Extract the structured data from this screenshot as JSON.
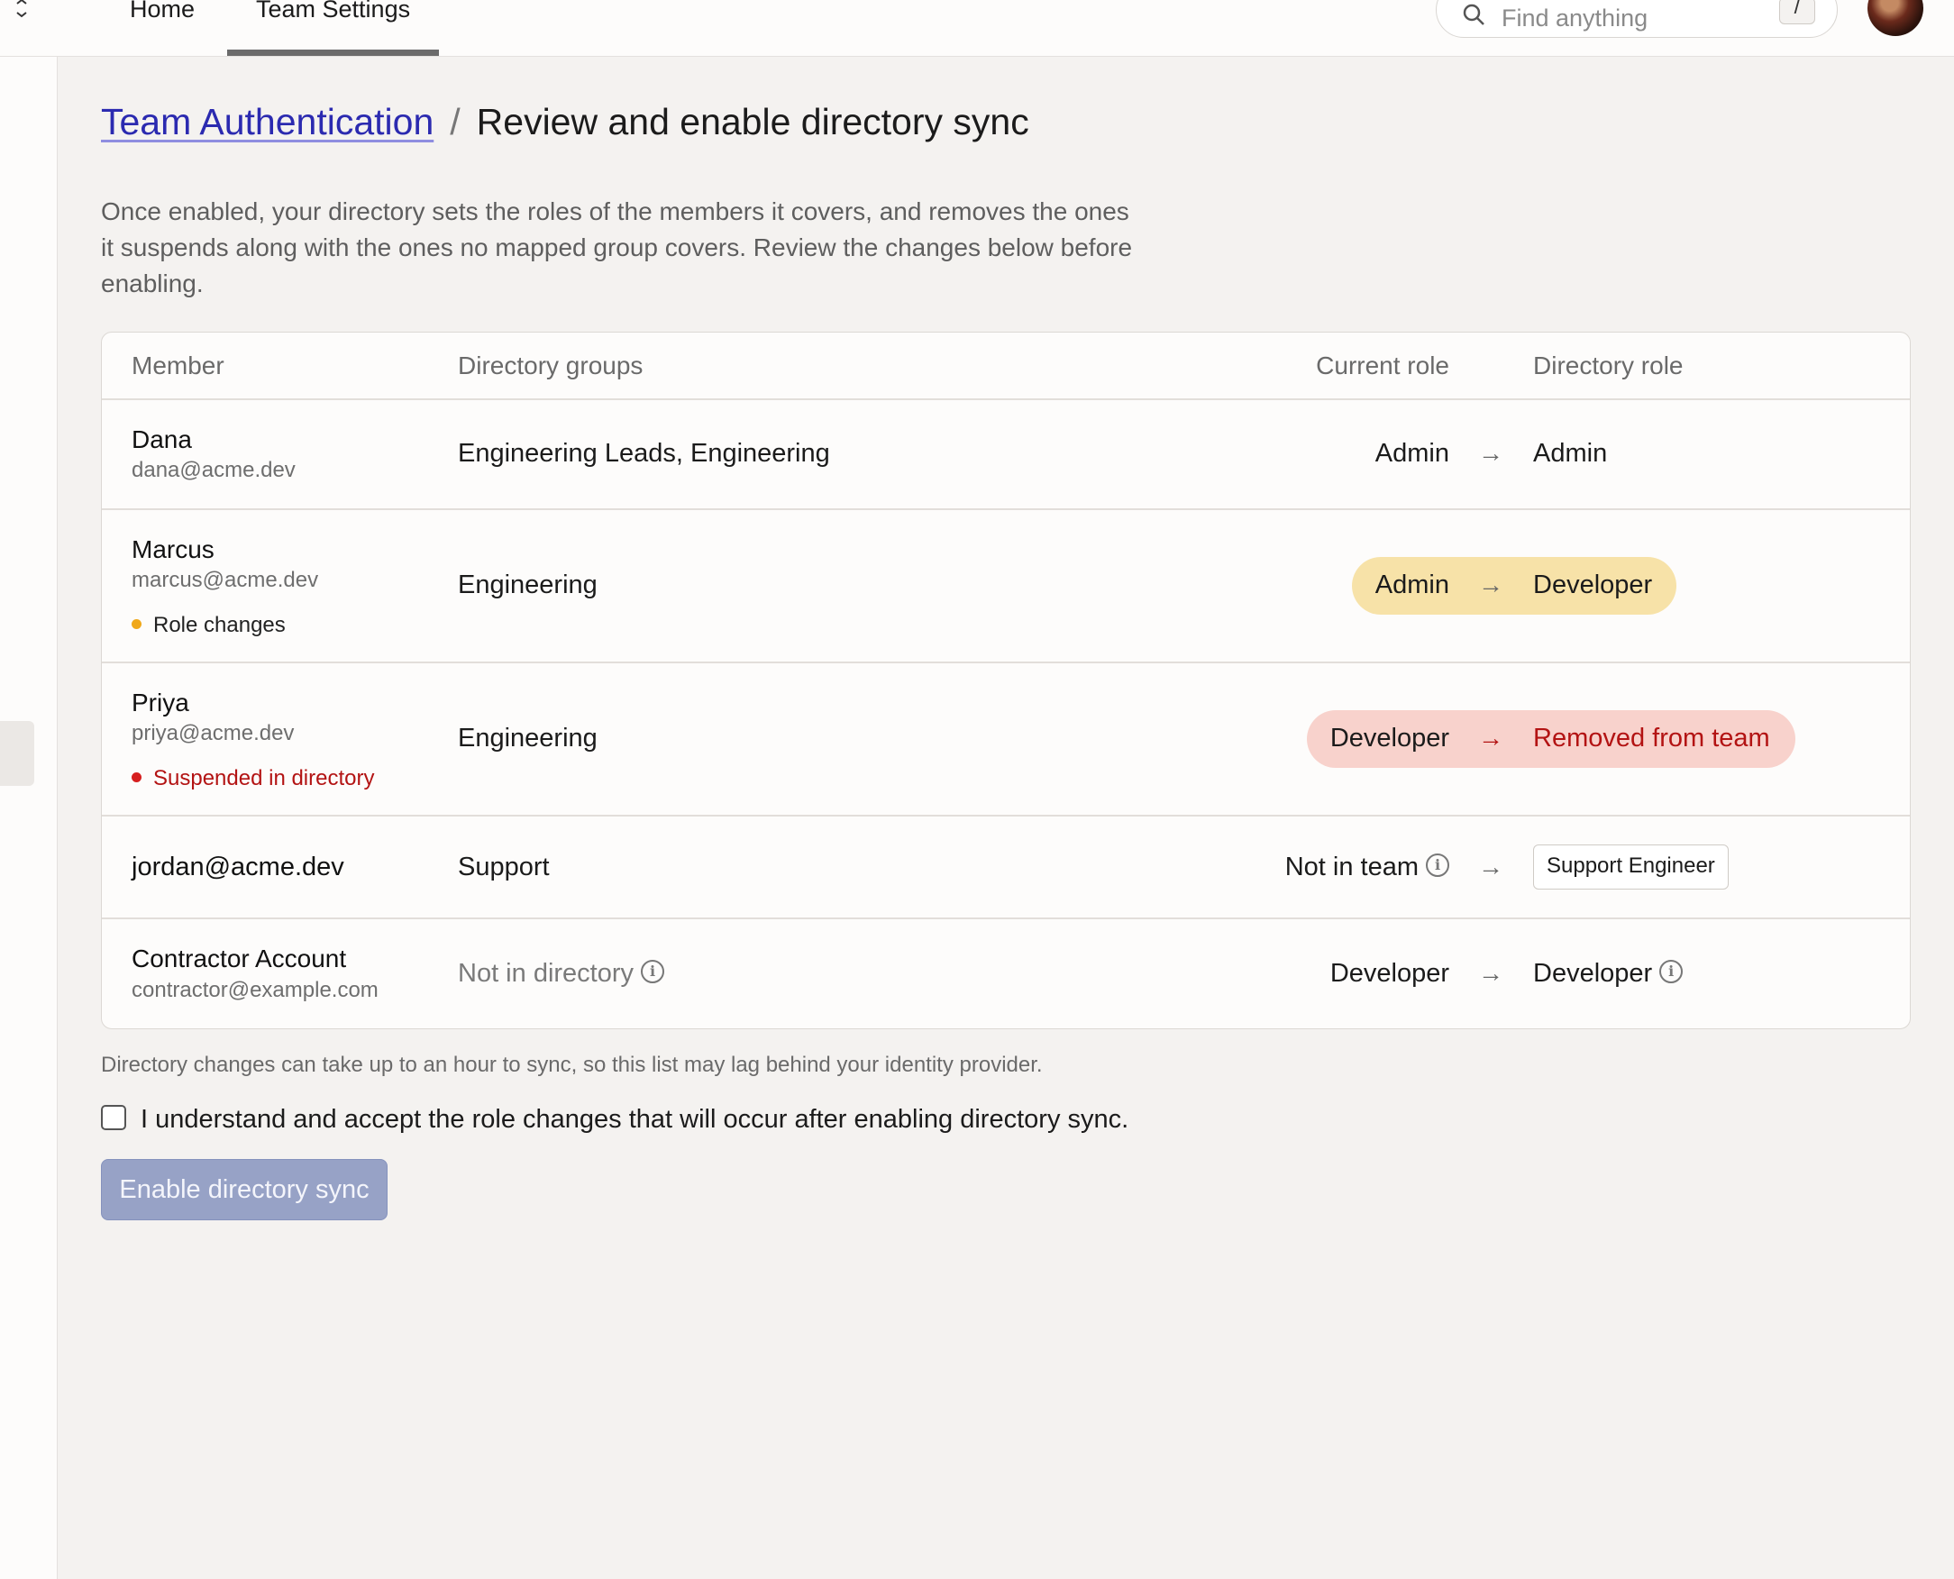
{
  "nav": {
    "tabs": [
      {
        "label": "Home",
        "active": false
      },
      {
        "label": "Team Settings",
        "active": true
      }
    ],
    "search_placeholder": "Find anything",
    "search_shortcut": "/"
  },
  "breadcrumb": {
    "parent": "Team Authentication",
    "separator": "/",
    "current": "Review and enable directory sync"
  },
  "intro": "Once enabled, your directory sets the roles of the members it covers, and removes the ones it suspends along with the ones no mapped group covers. Review the changes below before enabling.",
  "table": {
    "headers": {
      "member": "Member",
      "groups": "Directory groups",
      "current": "Current role",
      "directory": "Directory role"
    },
    "rows": [
      {
        "name": "Dana",
        "email": "dana@acme.dev",
        "groups": "Engineering Leads, Engineering",
        "current": "Admin",
        "arrow": "→",
        "directory": "Admin"
      },
      {
        "name": "Marcus",
        "email": "marcus@acme.dev",
        "status": "Role changes",
        "groups": "Engineering",
        "current": "Admin",
        "arrow": "→",
        "directory": "Developer"
      },
      {
        "name": "Priya",
        "email": "priya@acme.dev",
        "status": "Suspended in directory",
        "groups": "Engineering",
        "current": "Developer",
        "arrow": "→",
        "directory": "Removed from team"
      },
      {
        "name": "jordan@acme.dev",
        "groups": "Support",
        "current": "Not in team",
        "arrow": "→",
        "directory": "Support Engineer"
      },
      {
        "name": "Contractor Account",
        "email": "contractor@example.com",
        "groups": "Not in directory",
        "current": "Developer",
        "arrow": "→",
        "directory": "Developer"
      }
    ]
  },
  "note": "Directory changes can take up to an hour to sync, so this list may lag behind your identity provider.",
  "confirm_label": "I understand and accept the role changes that will occur after enabling directory sync.",
  "confirm_checked": false,
  "enable_button": "Enable directory sync",
  "info_glyph": "i",
  "colors": {
    "link": "#2b2ab0",
    "role_change_pill": "#f7e2a8",
    "removed_pill": "#f8d2cc",
    "removed_text": "#b31313",
    "warning_dot": "#f0a81a",
    "error_dot": "#d61f1f",
    "disabled_button": "#97a2c6"
  }
}
